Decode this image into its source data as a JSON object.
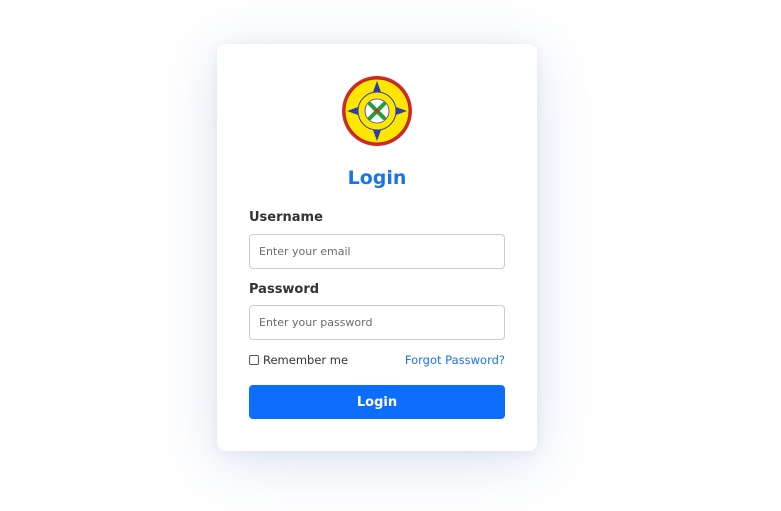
{
  "logo": {
    "icon": "emblem-logo",
    "colors": {
      "outer_ring": "#d42a2a",
      "fill": "#ffe600",
      "star": "#2b3fa8",
      "cross": "#21a038"
    }
  },
  "login_form": {
    "title": "Login",
    "username_label": "Username",
    "username_placeholder": "Enter your email",
    "username_value": "",
    "password_label": "Password",
    "password_placeholder": "Enter your password",
    "password_value": "",
    "remember_label": "Remember me",
    "remember_checked": false,
    "forgot_link": "Forgot Password?",
    "submit_label": "Login"
  },
  "colors": {
    "accent": "#1a73e8",
    "button": "#0d6efd"
  }
}
